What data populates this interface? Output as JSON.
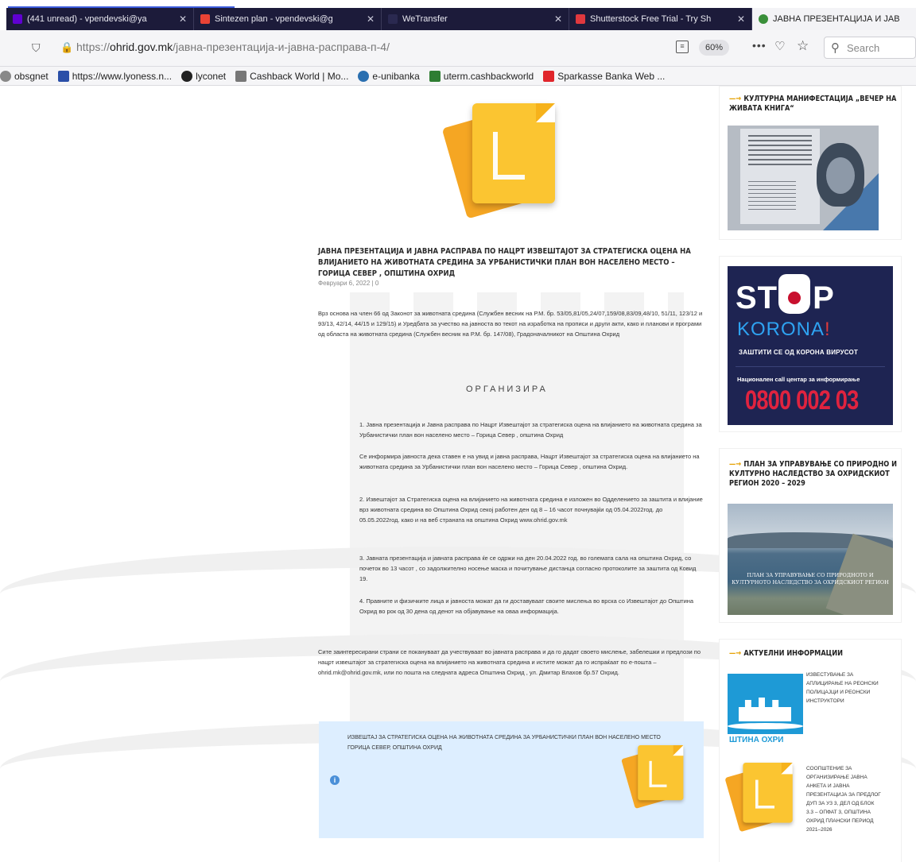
{
  "browser": {
    "tabs": [
      {
        "title": "(441 unread) - vpendevski@ya",
        "favicon_color": "#6001d2",
        "active": false
      },
      {
        "title": "Sintezen plan - vpendevski@g",
        "favicon_color": "#ea4335",
        "active": false
      },
      {
        "title": "WeTransfer",
        "favicon_color": "#1c1b3a",
        "active": false
      },
      {
        "title": "Shutterstock Free Trial - Try Sh",
        "favicon_color": "#e0383e",
        "active": false
      },
      {
        "title": "ЈАВНА ПРЕЗЕНТАЦИЈА И ЈАВ",
        "favicon_color": "#3a8f3a",
        "active": true
      }
    ],
    "url_prefix": "https://",
    "url_domain": "ohrid.gov.mk",
    "url_path": "/јавна-презентација-и-јавна-расправа-п-4/",
    "zoom": "60%",
    "search_placeholder": "Search",
    "more_glyph": "•••",
    "bookmarks": [
      {
        "label": "obsgnet",
        "color": "#888888"
      },
      {
        "label": "https://www.lyoness.n...",
        "color": "#2a4fa8"
      },
      {
        "label": "lyconet",
        "color": "#222222"
      },
      {
        "label": "Cashback World | Mo...",
        "color": "#555555"
      },
      {
        "label": "e-unibanka",
        "color": "#2a6fb0"
      },
      {
        "label": "uterm.cashbackworld",
        "color": "#2e7d32"
      },
      {
        "label": "Sparkasse Banka Web ...",
        "color": "#e0252b"
      }
    ]
  },
  "article": {
    "title": "ЈАВНА ПРЕЗЕНТАЦИЈА И ЈАВНА РАСПРАВА ПО НАЦРТ ИЗВЕШТАЈОТ ЗА СТРАТЕГИСКА ОЦЕНА НА ВЛИЈАНИЕТО НА ЖИВОТНАТА СРЕДИНА ЗА УРБАНИСТИЧКИ ПЛАН ВОН НАСЕЛЕНО МЕСТО – ГОРИЦА СЕВЕР , ОПШТИНА ОХРИД",
    "meta": "Февруари 6, 2022   |   0",
    "intro": "Врз основа на член 66 од Законот за животната средина (Службен весник на Р.М. бр. 53/05,81/05,24/07,159/08,83/09,48/10, 51/11, 123/12 и 93/13, 42/14, 44/15 и 129/15) и Уредбата за учество на јавноста во текот на изработка на прописи и други акти, како и планови и програми од областа на животната средина (Службен весник на Р.М. бр. 147/08), Градоначалникот на Општина Охрид",
    "org_heading": "ОРГАНИЗИРА",
    "paragraphs": [
      "1. Јавна презентација и Јавна расправа по Нацрт Извештајот за стратегиска оцена на влијанието на животната средина за Урбанистички план вон населено место – Горица Север , општина Охрид",
      "Се информира јавноста дека ставен е на увид и јавна расправа, Нацрт Извештајот за стратегиска оцена на влијанието на животната средина за Урбанистички план вон населено место – Горица Север , општина Охрид.",
      "2. Извештајот за Стратегиска оцена на влијанието на животната средина е изложен во Одделението за заштита и влијание врз животната средина во Општина Охрид секој работен ден од 8 – 16 часот почнувајќи од 05.04.2022год. до 05.05.2022год. како и на веб страната на општина Охрид www.ohrid.gov.mk",
      "3. Јавната презентација и јавната расправа ќе се одржи на ден 20.04.2022 год. во големата сала на општина Охрид, со почеток во 13 часот , со задолжително носење маска и почитување дистанца согласно протоколите за заштита од Ковид 19.",
      "4. Правните и физичките лица и јавноста можат да ги доставуваат своите мислења во врска со Извештајот до Општина Охрид во рок од 30 дена од денот на објавување на оваа информација."
    ],
    "closing": "Сите заинтересирани страни се покануваат да учествуваат во јавната расправа и да го дадат своето мислење, забелешки и предлози по нацрт извештајот за стратегиска оцена на влијанието на животната средина и истите можат да го испраќаат по е-пошта – ohrid.mk@ohrid.gov.mk, или по пошта на следната адреса Општина Охрид , ул. Дмитар Влахов бр.57 Охрид.",
    "attachment_title": "ИЗВЕШТАЈ ЗА СТРАТЕГИСКА ОЦЕНА НА ЖИВОТНАТА СРЕДИНА ЗА УРБАНИСТИЧКИ ПЛАН ВОН НАСЕЛЕНО МЕСТО ГОРИЦА СЕВЕР, ОПШТИНА ОХРИД",
    "info_glyph": "i"
  },
  "sidebar": {
    "arrow": "—→",
    "event_title": "КУЛТУРНА МАНИФЕСТАЦИЈА „ВЕЧЕР НА ЖИВАТА КНИГА“",
    "stop": {
      "word_left": "ST",
      "word_right": "P",
      "korona": "KORONA",
      "korona_bang": "!",
      "sub": "ЗАШТИТИ СЕ ОД КОРОНА ВИРУСОТ",
      "call": "Национален call центар за информирање",
      "number": "0800 002 03"
    },
    "plan_title": "ПЛАН ЗА УПРАВУВАЊЕ СО ПРИРОДНО И КУЛТУРНО НАСЛЕДСТВО ЗА ОХРИДСКИОТ РЕГИОН 2020 – 2029",
    "plan_caption": "ПЛАН ЗА УПРАВУВАЊЕ СО ПРИРОДНОТО И КУЛТУРНОТО НАСЛЕДСТВО ЗА ОХРИДСКИОТ РЕГИОН",
    "news_title": "АКТУЕЛНИ ИНФОРМАЦИИ",
    "logo_text": "ШТИНА ОХРИ",
    "news_items": [
      "ИЗВЕСТУВАЊЕ ЗА АПЛИЦИРАЊЕ НА РЕОНСКИ ПОЛИЦАЈЦИ И РЕОНСКИ ИНСТРУКТОРИ",
      "СООПШТЕНИЕ ЗА ОРГАНИЗИРАЊЕ ЈАВНА АНКЕТА И ЈАВНА ПРЕЗЕНТАЦИЈА ЗА ПРЕДЛОГ ДУП ЗА УЗ 3, ДЕЛ ОД БЛОК 3.3 – ОПФАТ 3, ОПШТИНА ОХРИД ПЛАНСКИ ПЕРИОД 2021–2026"
    ]
  }
}
